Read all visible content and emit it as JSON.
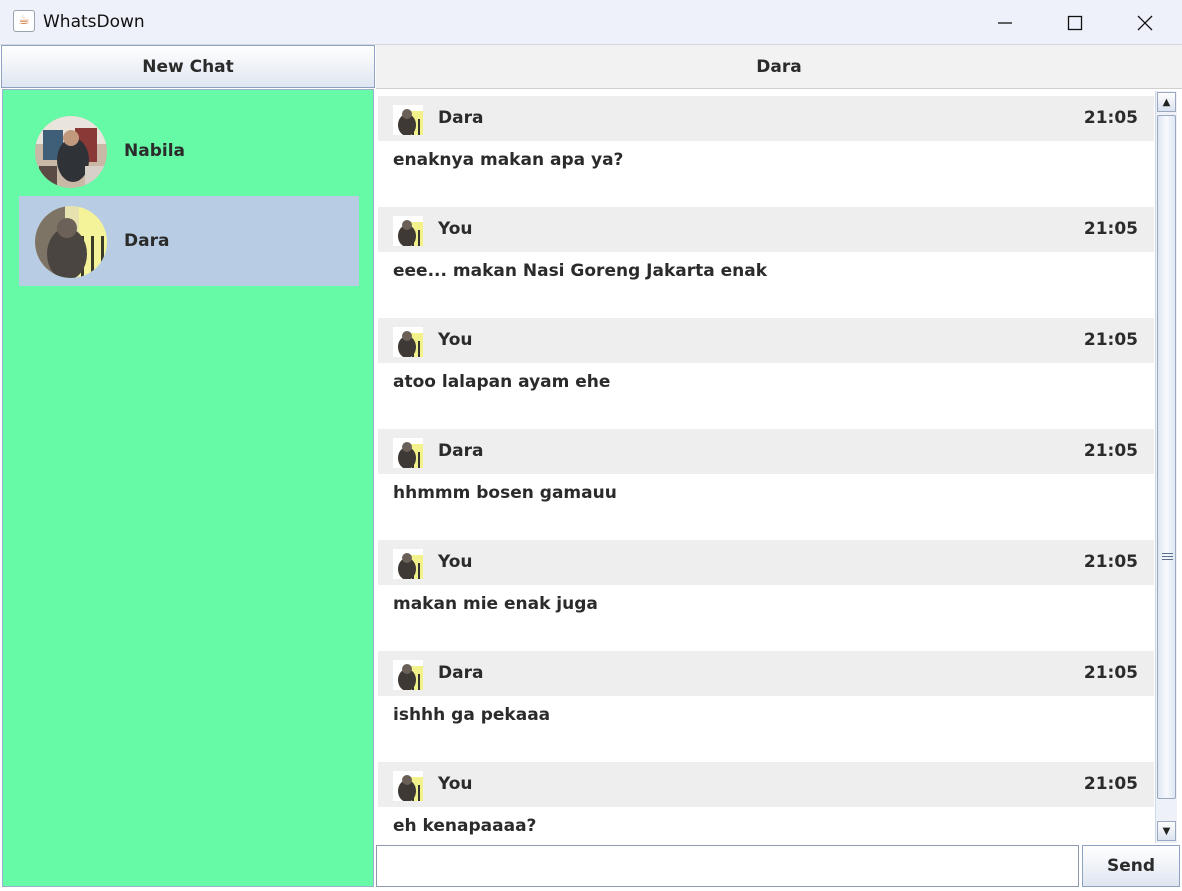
{
  "window": {
    "title": "WhatsDown",
    "app_icon": "java-cup-icon",
    "app_icon_glyph": "☕"
  },
  "sidebar": {
    "new_chat_label": "New Chat",
    "contacts": [
      {
        "name": "Nabila",
        "selected": false
      },
      {
        "name": "Dara",
        "selected": true
      }
    ]
  },
  "chat": {
    "header": "Dara",
    "messages": [
      {
        "sender": "Dara",
        "time": "21:05",
        "text": "enaknya makan apa ya?"
      },
      {
        "sender": "You",
        "time": "21:05",
        "text": "eee... makan Nasi Goreng Jakarta enak"
      },
      {
        "sender": "You",
        "time": "21:05",
        "text": "atoo lalapan ayam ehe"
      },
      {
        "sender": "Dara",
        "time": "21:05",
        "text": "hhmmm bosen gamauu"
      },
      {
        "sender": "You",
        "time": "21:05",
        "text": "makan mie enak juga"
      },
      {
        "sender": "Dara",
        "time": "21:05",
        "text": "ishhh ga pekaaa"
      },
      {
        "sender": "You",
        "time": "21:05",
        "text": "eh kenapaaaa?"
      }
    ],
    "input_value": "",
    "send_label": "Send"
  },
  "colors": {
    "sidebar_bg": "#66f9a6",
    "selected_bg": "#b8cde4",
    "message_header_bg": "#eeeeee"
  }
}
